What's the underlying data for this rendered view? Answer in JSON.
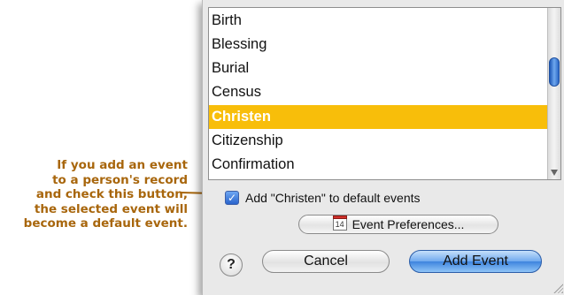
{
  "callout": {
    "lines": [
      "If you add an event",
      "to a person's record",
      "and check this button,",
      "the selected event will",
      "become a default event."
    ]
  },
  "dialog": {
    "events": [
      "Birth",
      "Blessing",
      "Burial",
      "Census",
      "Christen",
      "Citizenship",
      "Confirmation"
    ],
    "selected_event": "Christen",
    "checkbox_label": "Add \"Christen\" to default events",
    "checkbox_checked": true,
    "preferences_button": "Event Preferences...",
    "calendar_icon_day": "14",
    "help_button": "?",
    "cancel_button": "Cancel",
    "add_button": "Add Event"
  },
  "colors": {
    "selection": "#f8be0a",
    "callout_text": "#a8660c",
    "default_button": "#6fa9ee"
  }
}
